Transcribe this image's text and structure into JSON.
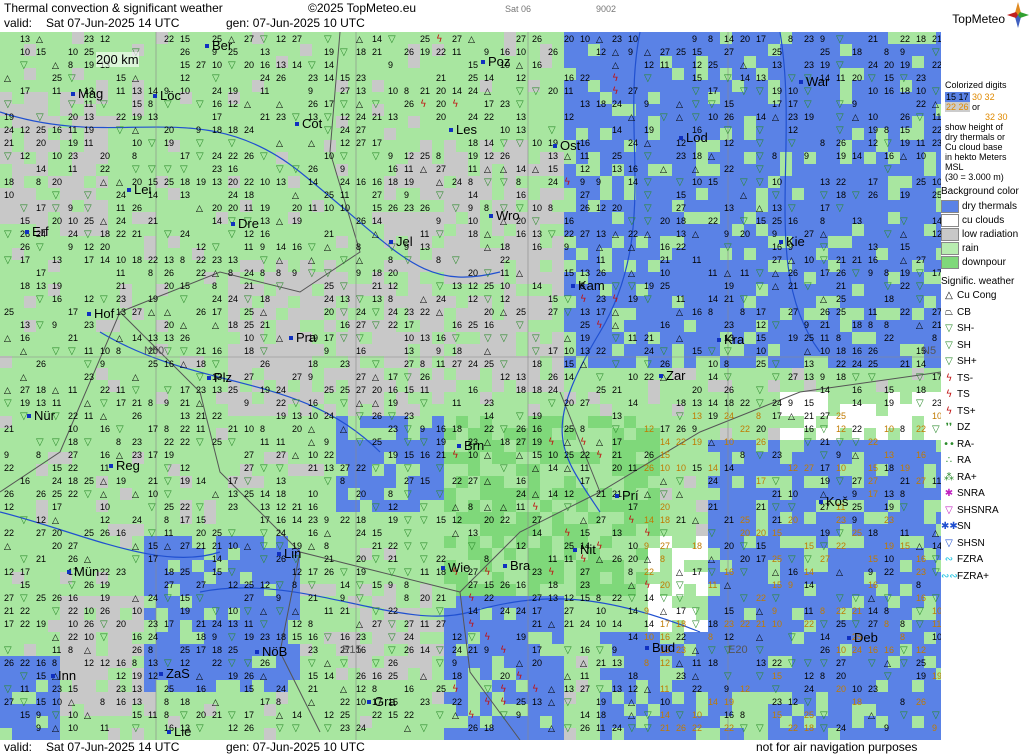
{
  "header": {
    "title": "Thermal convection & significant weather",
    "copyright": "©2025 TopMeteo.eu",
    "small_1": "Sat 06",
    "small_2": "9002",
    "valid_label": "valid:",
    "valid_value": "Sat   07-Jun-2025   14 UTC",
    "gen_value": "gen: 07-Jun-2025 10 UTC",
    "brand": "TopMeteo"
  },
  "map": {
    "scale_label": "200 km",
    "grid_labels": [
      "N50",
      "E15",
      "E20",
      "N5"
    ],
    "cities": [
      "Ber",
      "Poz",
      "War",
      "Mag",
      "Löc",
      "Cot",
      "Les",
      "Lod",
      "Ost",
      "Lei",
      "Erf",
      "Dre",
      "Wro",
      "Jel",
      "Kie",
      "Kam",
      "Hof",
      "Pra",
      "Kra",
      "Plz",
      "Zar",
      "Nür",
      "Brn",
      "Reg",
      "Prí",
      "Koš",
      "Mün",
      "Lin",
      "Wie",
      "Bra",
      "Nit",
      "Inn",
      "ZaS",
      "NöB",
      "Bud",
      "Deb",
      "Gra",
      "Lie"
    ],
    "colors": {
      "rain": "#9fe09a",
      "dry_thermals": "#5a82e6",
      "cu_clouds": "#ffffff",
      "low_radiation": "#c8c8c8",
      "downpour": "#7fd87a",
      "symbol_red": "#c01010",
      "symbol_green": "#2a8a2a"
    }
  },
  "legend": {
    "colorized_title": [
      "Colorized digits",
      "show height of",
      "dry thermals or",
      "Cu cloud base",
      "in hekto Meters",
      "MSL",
      "(30 = 3.000 m)"
    ],
    "sample_1": "15 17",
    "sample_2": "30 32",
    "sample_3": "22 26",
    "sample_4": "32 30",
    "or": "or",
    "background_title": "Background color",
    "backgrounds": [
      {
        "label": "dry thermals",
        "color": "#5a82e6"
      },
      {
        "label": "cu clouds",
        "color": "#ffffff"
      },
      {
        "label": "low radiation",
        "color": "#c8c8c8"
      },
      {
        "label": "rain",
        "color": "#b8ecb0"
      },
      {
        "label": "downpour",
        "color": "#7fd87a"
      }
    ],
    "weather_title": "Signific. weather",
    "weather": [
      {
        "label": "Cu Cong",
        "icon": "cu-cong-icon",
        "glyph": "△"
      },
      {
        "label": "CB",
        "icon": "cb-icon",
        "glyph": "⏢"
      },
      {
        "label": "SH-",
        "icon": "shower-light-icon",
        "glyph": "▽"
      },
      {
        "label": "SH",
        "icon": "shower-icon",
        "glyph": "▽"
      },
      {
        "label": "SH+",
        "icon": "shower-heavy-icon",
        "glyph": "▽"
      },
      {
        "label": "TS-",
        "icon": "thunderstorm-light-icon",
        "glyph": "ϟ"
      },
      {
        "label": "TS",
        "icon": "thunderstorm-icon",
        "glyph": "ϟ"
      },
      {
        "label": "TS+",
        "icon": "thunderstorm-heavy-icon",
        "glyph": "ϟ"
      },
      {
        "label": "DZ",
        "icon": "drizzle-icon",
        "glyph": "❜❜"
      },
      {
        "label": "RA-",
        "icon": "rain-light-icon",
        "glyph": "••"
      },
      {
        "label": "RA",
        "icon": "rain-icon",
        "glyph": "∴"
      },
      {
        "label": "RA+",
        "icon": "rain-heavy-icon",
        "glyph": "⁂"
      },
      {
        "label": "SNRA",
        "icon": "snow-rain-icon",
        "glyph": "✱"
      },
      {
        "label": "SHSNRA",
        "icon": "shower-snow-rain-icon",
        "glyph": "▽"
      },
      {
        "label": "SN",
        "icon": "snow-icon",
        "glyph": "✱✱"
      },
      {
        "label": "SHSN",
        "icon": "shower-snow-icon",
        "glyph": "▽"
      },
      {
        "label": "FZRA",
        "icon": "freezing-rain-icon",
        "glyph": "∾"
      },
      {
        "label": "FZRA+",
        "icon": "freezing-rain-heavy-icon",
        "glyph": "∾∾"
      }
    ]
  },
  "footer": {
    "valid_label": "valid:",
    "valid_value": "Sat   07-Jun-2025   14 UTC",
    "gen_value": "gen: 07-Jun-2025 10 UTC",
    "note": "not for air navigation purposes"
  }
}
